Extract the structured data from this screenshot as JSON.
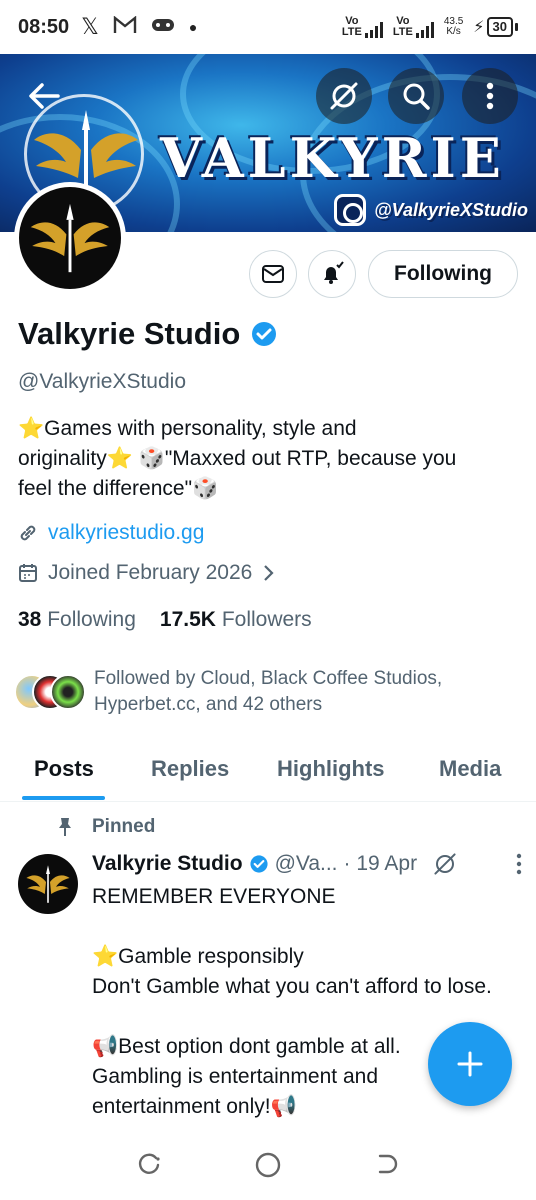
{
  "status_bar": {
    "time": "08:50",
    "net1": "Vo\nLTE",
    "net2": "Vo\nLTE",
    "speed": "43.5\nK/s",
    "battery": "30"
  },
  "banner": {
    "title": "VALKYRIE",
    "instagram_handle": "@ValkyrieXStudio"
  },
  "actions": {
    "following_label": "Following"
  },
  "profile": {
    "name": "Valkyrie Studio",
    "handle": "@ValkyrieXStudio",
    "bio_line1": "⭐Games with personality, style and",
    "bio_line2": "originality⭐ 🎲\"Maxxed out RTP, because you",
    "bio_line3": "feel the difference\"🎲",
    "website": "valkyriestudio.gg",
    "joined": "Joined February 2026",
    "following_count": "38",
    "following_label": "Following",
    "followers_count": "17.5K",
    "followers_label": "Followers",
    "followed_by": "Followed by Cloud, Black Coffee Studios, Hyperbet.cc, and 42 others"
  },
  "tabs": [
    {
      "label": "Posts"
    },
    {
      "label": "Replies"
    },
    {
      "label": "Highlights"
    },
    {
      "label": "Media"
    }
  ],
  "pinned_post": {
    "pinned_label": "Pinned",
    "author": "Valkyrie Studio",
    "handle_trunc": "@Va...",
    "date": "· 19 Apr",
    "text": "  REMEMBER EVERYONE\n\n⭐Gamble responsibly\nDon't Gamble what you can't afford to lose.\n\n📢Best option dont gamble at all.\nGambling is entertainment and\nentertainment only!📢"
  },
  "colors": {
    "accent": "#1d9bf0",
    "secondary_text": "#536471",
    "primary_text": "#0f1419"
  }
}
